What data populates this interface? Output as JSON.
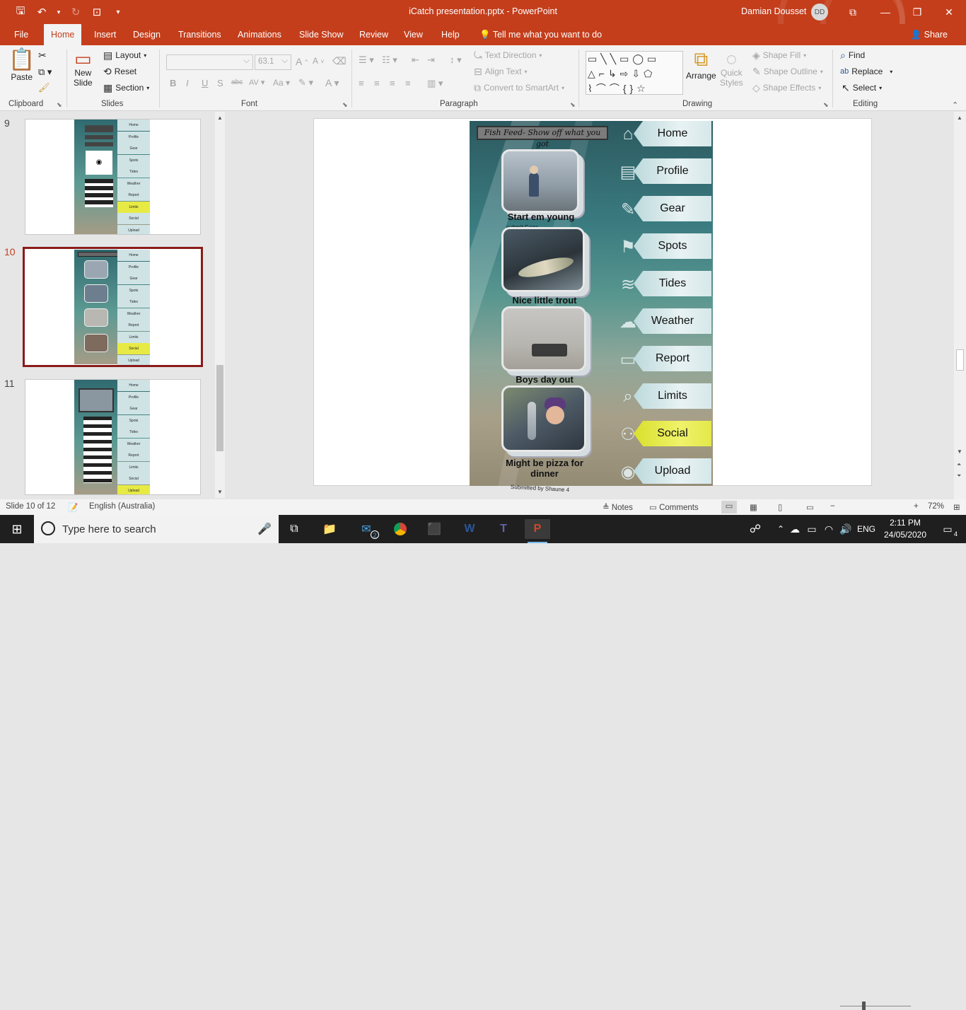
{
  "titlebar": {
    "title": "iCatch presentation.pptx  -  PowerPoint",
    "user_name": "Damian Dousset",
    "avatar_initials": "DD"
  },
  "tabs": [
    "File",
    "Home",
    "Insert",
    "Design",
    "Transitions",
    "Animations",
    "Slide Show",
    "Review",
    "View",
    "Help"
  ],
  "tell_me": "Tell me what you want to do",
  "share": "Share",
  "ribbon": {
    "clipboard": {
      "paste": "Paste",
      "label": "Clipboard"
    },
    "slides": {
      "new_slide_line1": "New",
      "new_slide_line2": "Slide",
      "layout": "Layout",
      "reset": "Reset",
      "section": "Section",
      "label": "Slides"
    },
    "font": {
      "font_size": "63.1",
      "label": "Font"
    },
    "paragraph": {
      "text_direction": "Text Direction",
      "align_text": "Align Text",
      "convert": "Convert to SmartArt",
      "label": "Paragraph"
    },
    "drawing": {
      "arrange": "Arrange",
      "quick_styles_line1": "Quick",
      "quick_styles_line2": "Styles",
      "shape_fill": "Shape Fill",
      "shape_outline": "Shape Outline",
      "shape_effects": "Shape Effects",
      "label": "Drawing"
    },
    "editing": {
      "find": "Find",
      "replace": "Replace",
      "select": "Select",
      "label": "Editing"
    }
  },
  "thumbnails": {
    "numbers": [
      "9",
      "10",
      "11"
    ],
    "nav_labels": [
      "Home",
      "Profile",
      "Gear",
      "Spots",
      "Tides",
      "Weather",
      "Report",
      "Limits",
      "Social",
      "Upload"
    ]
  },
  "slide": {
    "feed_title": "Fish Feed- Show off what you got",
    "posts": [
      {
        "caption": "Start em young"
      },
      {
        "caption": "Nice little trout"
      },
      {
        "caption": "Boys day out"
      },
      {
        "caption": "Might be pizza for dinner"
      }
    ],
    "overlay_text": "submit Gaza",
    "submitted_by": "Submitted by Shaune 4",
    "nav": [
      {
        "label": "Home",
        "icon": "home-icon",
        "glyph": "⌂"
      },
      {
        "label": "Profile",
        "icon": "profile-card-icon",
        "glyph": "▤"
      },
      {
        "label": "Gear",
        "icon": "fishing-gear-icon",
        "glyph": "✎"
      },
      {
        "label": "Spots",
        "icon": "map-icon",
        "glyph": "⚑"
      },
      {
        "label": "Tides",
        "icon": "wave-icon",
        "glyph": "≋"
      },
      {
        "label": "Weather",
        "icon": "weather-icon",
        "glyph": "☁"
      },
      {
        "label": "Report",
        "icon": "truck-icon",
        "glyph": "▭"
      },
      {
        "label": "Limits",
        "icon": "magnifier-icon",
        "glyph": "⌕"
      },
      {
        "label": "Social",
        "icon": "people-icon",
        "glyph": "⚇",
        "active": true
      },
      {
        "label": "Upload",
        "icon": "camera-icon",
        "glyph": "◉"
      }
    ]
  },
  "status": {
    "slide_info": "Slide 10 of 12",
    "language": "English (Australia)",
    "notes": "Notes",
    "comments": "Comments",
    "zoom": "72%"
  },
  "taskbar": {
    "search_placeholder": "Type here to search",
    "mail_badge": "2",
    "language": "ENG",
    "time": "2:11 PM",
    "date": "24/05/2020",
    "notification_count": "4"
  }
}
